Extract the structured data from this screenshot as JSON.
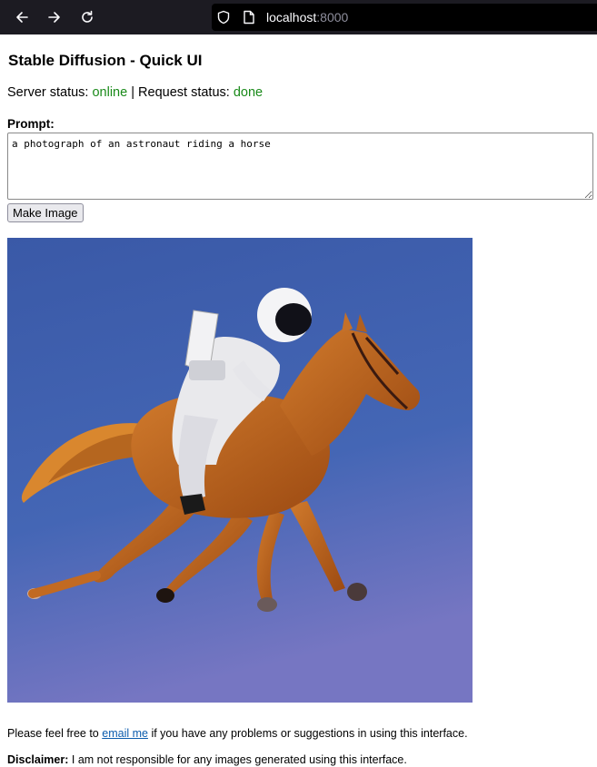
{
  "browser": {
    "url_host": "localhost",
    "url_port": ":8000"
  },
  "page": {
    "title": "Stable Diffusion - Quick UI",
    "server_status_label": "Server status:",
    "server_status_value": "online",
    "separator": "|",
    "request_status_label": "Request status:",
    "request_status_value": "done",
    "prompt_label": "Prompt:",
    "prompt_value": "a photograph of an astronaut riding a horse",
    "make_button_label": "Make Image",
    "footer_prefix": "Please feel free to",
    "footer_link": "email me",
    "footer_suffix": "if you have any problems or suggestions in using this interface.",
    "disclaimer_label": "Disclaimer:",
    "disclaimer_text": "I am not responsible for any images generated using this interface."
  },
  "colors": {
    "status_ok": "#1a8a1a",
    "link": "#0b5cad",
    "browser_chrome": "#1c1b22"
  }
}
